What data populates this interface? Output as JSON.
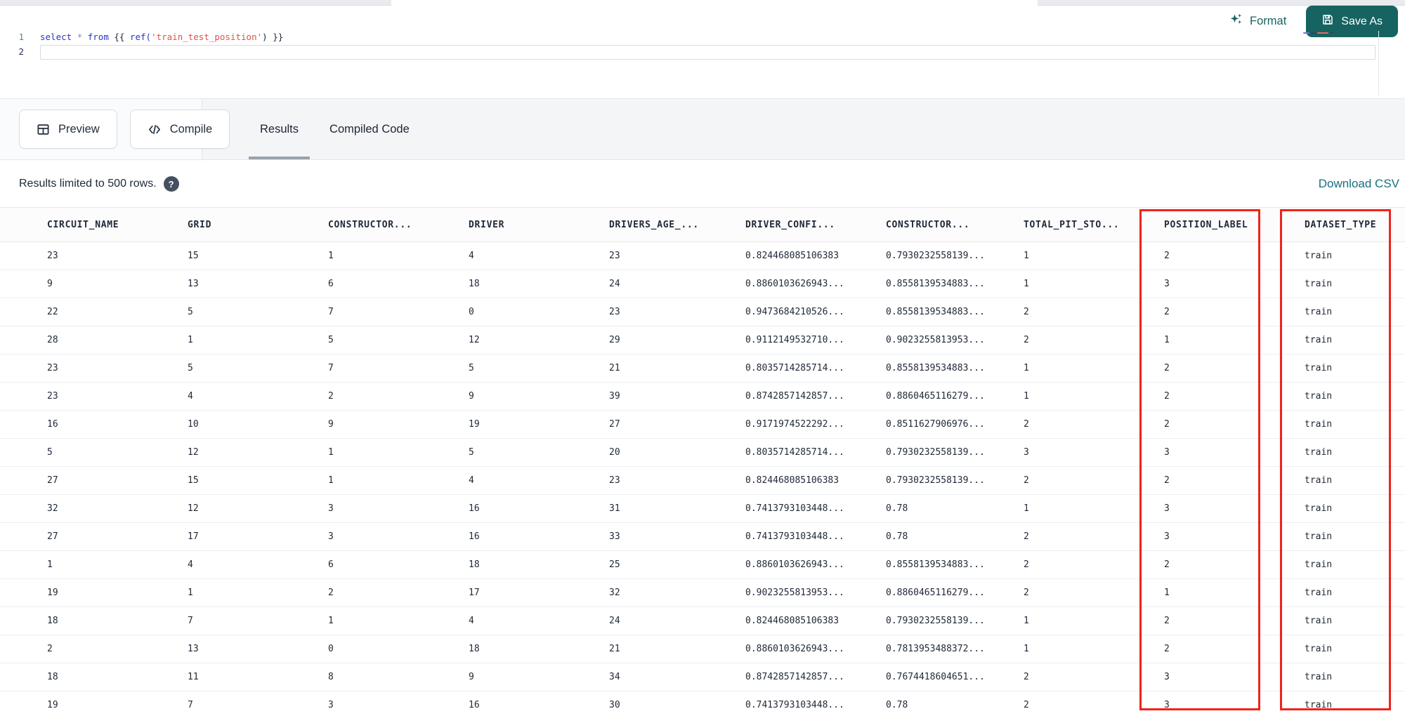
{
  "header": {
    "format_label": "Format",
    "save_as_label": "Save As"
  },
  "editor": {
    "line_numbers": [
      "1",
      "2"
    ],
    "code": {
      "kw_select": "select ",
      "op_star": "* ",
      "kw_from": "from ",
      "open_braces": "{{ ",
      "fn_ref": "ref(",
      "str_model": "'train_test_position'",
      "close_paren": ") ",
      "close_braces": "}}"
    }
  },
  "toolbar": {
    "preview_label": "Preview",
    "compile_label": "Compile",
    "tabs": [
      {
        "label": "Results",
        "active": true
      },
      {
        "label": "Compiled Code",
        "active": false
      }
    ]
  },
  "results_bar": {
    "message": "Results limited to 500 rows.",
    "help_glyph": "?",
    "download_label": "Download CSV"
  },
  "table": {
    "headers": [
      "CIRCUIT_NAME",
      "GRID",
      "CONSTRUCTOR...",
      "DRIVER",
      "DRIVERS_AGE_...",
      "DRIVER_CONFI...",
      "CONSTRUCTOR...",
      "TOTAL_PIT_STO...",
      "POSITION_LABEL",
      "DATASET_TYPE"
    ],
    "rows": [
      [
        "23",
        "15",
        "1",
        "4",
        "23",
        "0.824468085106383",
        "0.7930232558139...",
        "1",
        "2",
        "train"
      ],
      [
        "9",
        "13",
        "6",
        "18",
        "24",
        "0.8860103626943...",
        "0.8558139534883...",
        "1",
        "3",
        "train"
      ],
      [
        "22",
        "5",
        "7",
        "0",
        "23",
        "0.9473684210526...",
        "0.8558139534883...",
        "2",
        "2",
        "train"
      ],
      [
        "28",
        "1",
        "5",
        "12",
        "29",
        "0.9112149532710...",
        "0.9023255813953...",
        "2",
        "1",
        "train"
      ],
      [
        "23",
        "5",
        "7",
        "5",
        "21",
        "0.8035714285714...",
        "0.8558139534883...",
        "1",
        "2",
        "train"
      ],
      [
        "23",
        "4",
        "2",
        "9",
        "39",
        "0.8742857142857...",
        "0.8860465116279...",
        "1",
        "2",
        "train"
      ],
      [
        "16",
        "10",
        "9",
        "19",
        "27",
        "0.9171974522292...",
        "0.8511627906976...",
        "2",
        "2",
        "train"
      ],
      [
        "5",
        "12",
        "1",
        "5",
        "20",
        "0.8035714285714...",
        "0.7930232558139...",
        "3",
        "3",
        "train"
      ],
      [
        "27",
        "15",
        "1",
        "4",
        "23",
        "0.824468085106383",
        "0.7930232558139...",
        "2",
        "2",
        "train"
      ],
      [
        "32",
        "12",
        "3",
        "16",
        "31",
        "0.7413793103448...",
        "0.78",
        "1",
        "3",
        "train"
      ],
      [
        "27",
        "17",
        "3",
        "16",
        "33",
        "0.7413793103448...",
        "0.78",
        "2",
        "3",
        "train"
      ],
      [
        "1",
        "4",
        "6",
        "18",
        "25",
        "0.8860103626943...",
        "0.8558139534883...",
        "2",
        "2",
        "train"
      ],
      [
        "19",
        "1",
        "2",
        "17",
        "32",
        "0.9023255813953...",
        "0.8860465116279...",
        "2",
        "1",
        "train"
      ],
      [
        "18",
        "7",
        "1",
        "4",
        "24",
        "0.824468085106383",
        "0.7930232558139...",
        "1",
        "2",
        "train"
      ],
      [
        "2",
        "13",
        "0",
        "18",
        "21",
        "0.8860103626943...",
        "0.7813953488372...",
        "1",
        "2",
        "train"
      ],
      [
        "18",
        "11",
        "8",
        "9",
        "34",
        "0.8742857142857...",
        "0.7674418604651...",
        "2",
        "3",
        "train"
      ],
      [
        "19",
        "7",
        "3",
        "16",
        "30",
        "0.7413793103448...",
        "0.78",
        "2",
        "3",
        "train"
      ]
    ]
  },
  "colors": {
    "button_teal": "#166361",
    "link_teal": "#17707f",
    "annotation_red": "#ef231c",
    "keyword_blue": "#2d35c8",
    "string_red": "#e25049"
  }
}
